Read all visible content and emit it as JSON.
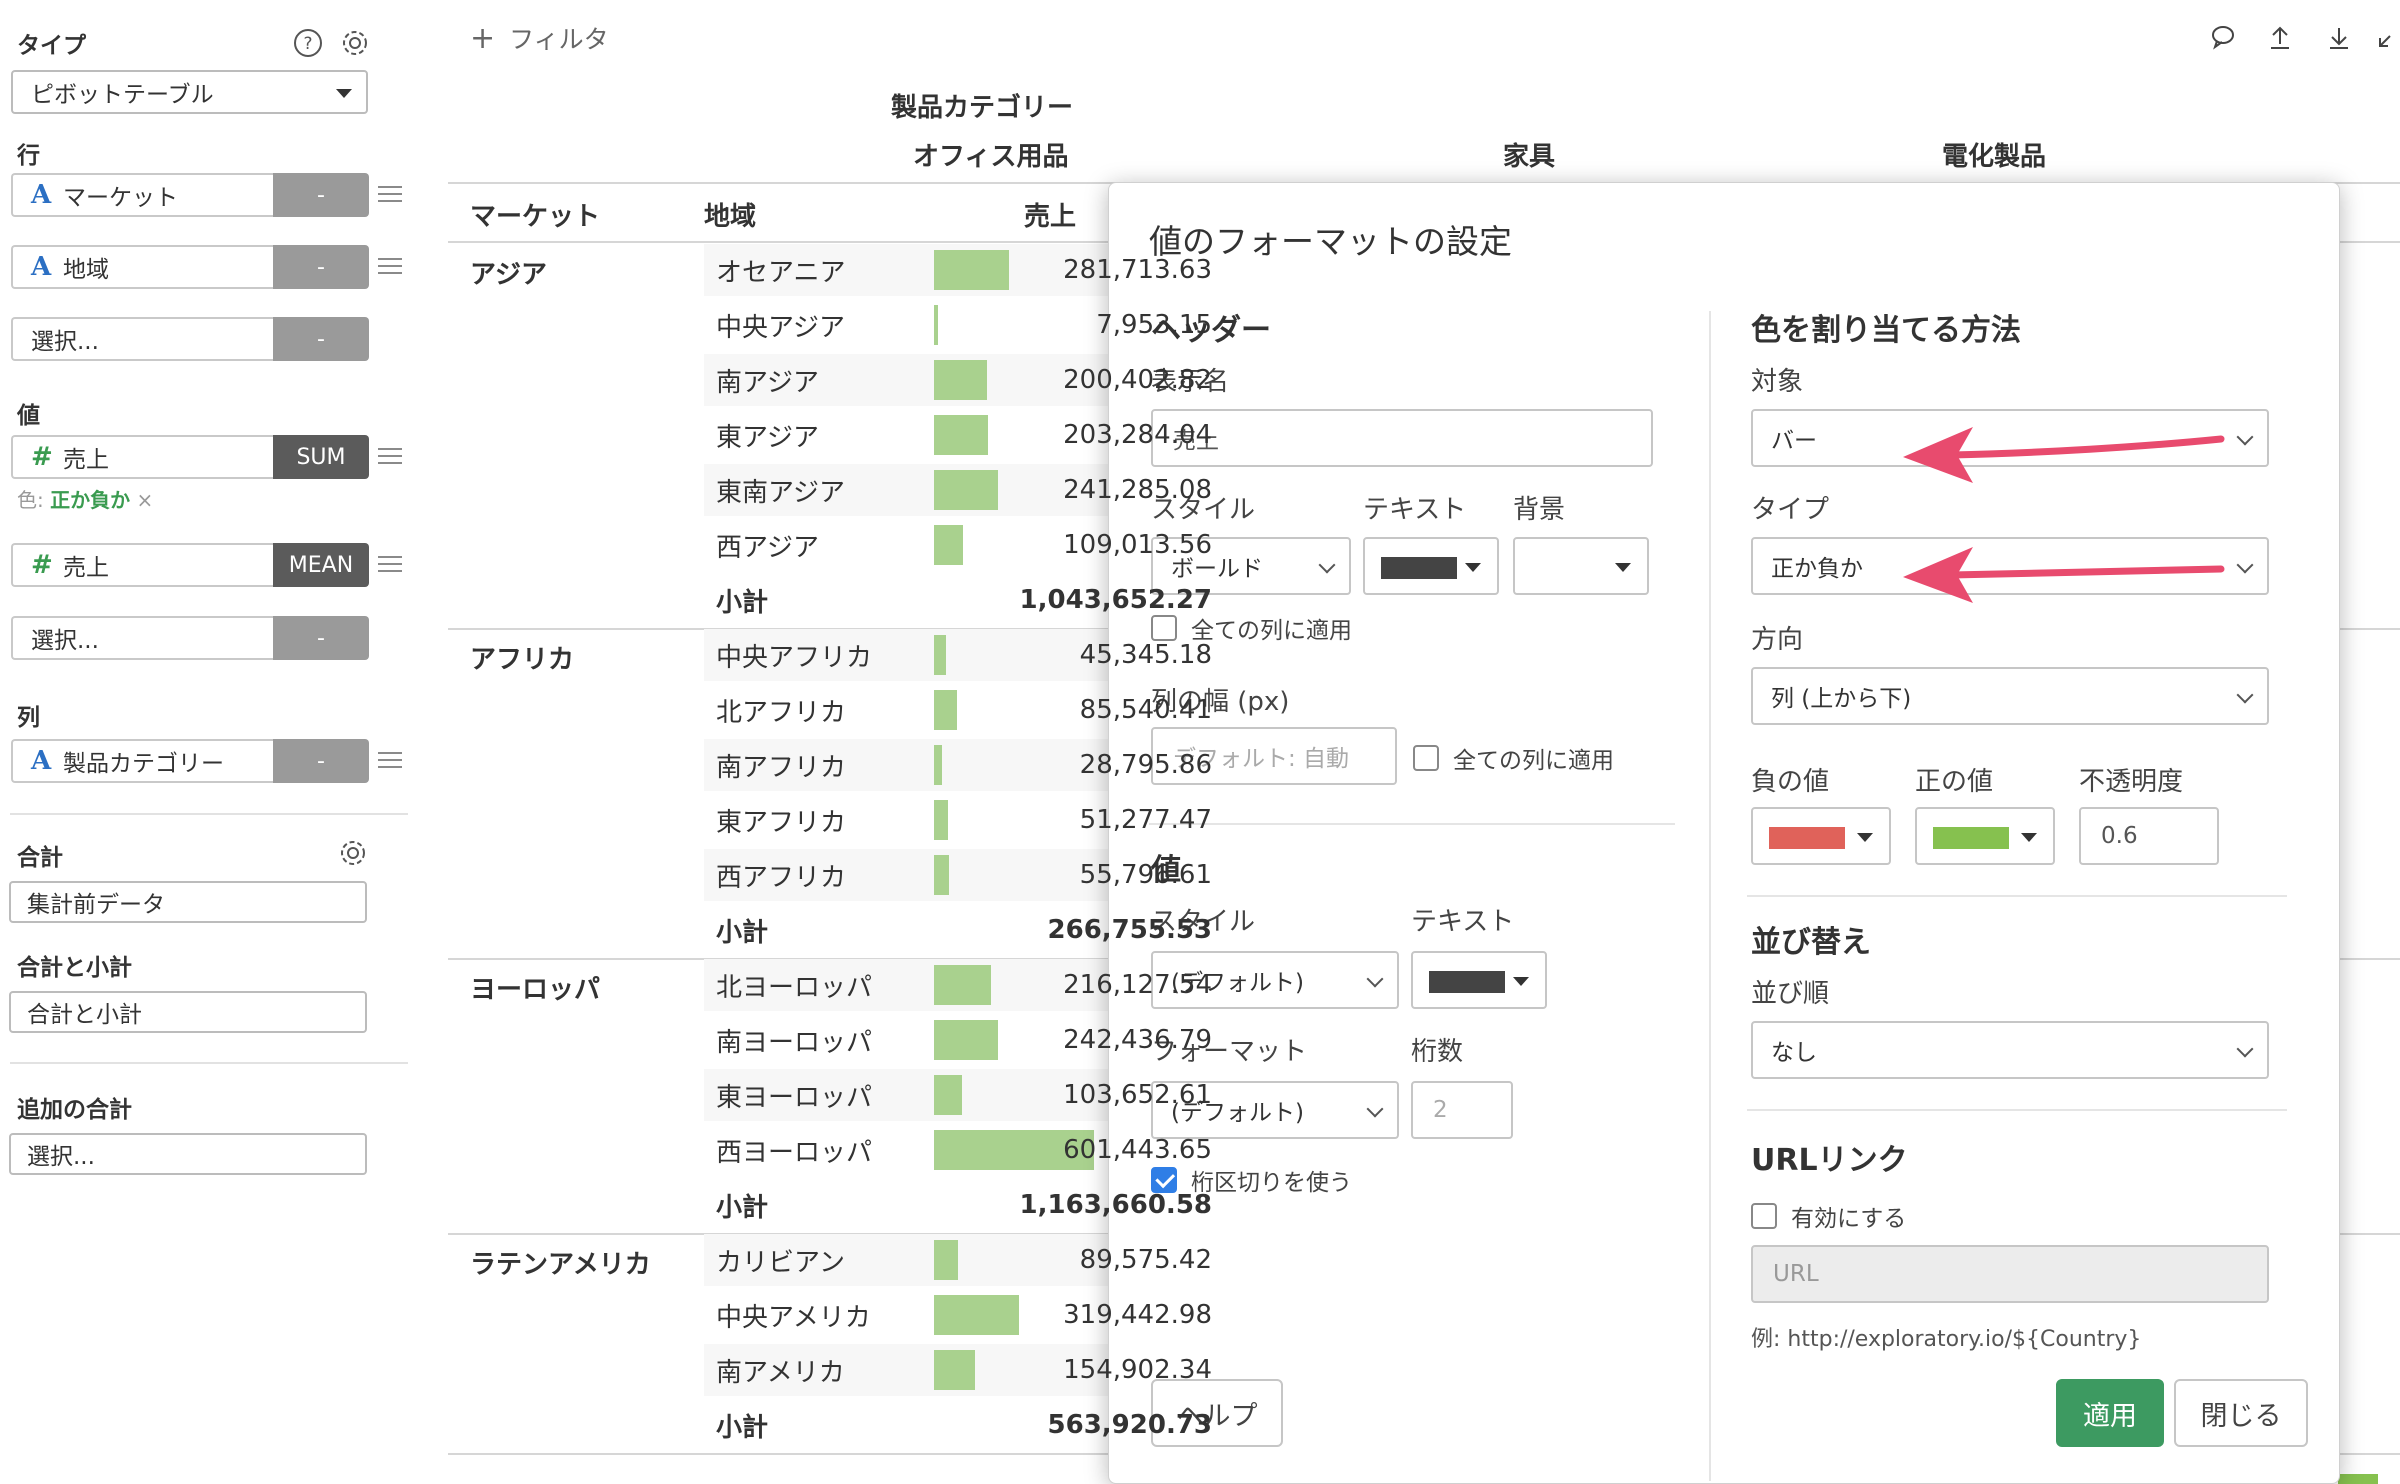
{
  "sidebar": {
    "type_label": "タイプ",
    "type_value": "ピボットテーブル",
    "rows_label": "行",
    "rows": [
      {
        "type": "A",
        "name": "マーケット",
        "agg": "-"
      },
      {
        "type": "A",
        "name": "地域",
        "agg": "-"
      },
      {
        "type": "",
        "name": "選択...",
        "agg": "-"
      }
    ],
    "values_label": "値",
    "values": [
      {
        "type": "#",
        "name": "売上",
        "agg": "SUM"
      },
      {
        "type": "#",
        "name": "売上",
        "agg": "MEAN"
      },
      {
        "type": "",
        "name": "選択...",
        "agg": "-"
      }
    ],
    "color_prefix": "色:",
    "color_value": "正か負か",
    "color_remove": "×",
    "columns_label": "列",
    "columns": [
      {
        "type": "A",
        "name": "製品カテゴリー",
        "agg": "-"
      }
    ],
    "total_label": "合計",
    "total_value": "集計前データ",
    "subtotal_label": "合計と小計",
    "subtotal_value": "合計と小計",
    "extra_total_label": "追加の合計",
    "extra_total_value": "選択..."
  },
  "toolbar": {
    "filter_label": "フィルタ",
    "plus": "+"
  },
  "pivot": {
    "column_group_header": "製品カテゴリー",
    "col_categories": [
      "オフィス用品",
      "家具",
      "電化製品"
    ],
    "headers": {
      "market": "マーケット",
      "region": "地域",
      "value": "売上"
    },
    "bar_max": 601443.65,
    "groups": [
      {
        "market": "アジア",
        "rows": [
          {
            "region": "オセアニア",
            "value": "281,713.63",
            "num": 281713.63
          },
          {
            "region": "中央アジア",
            "value": "7,953.15",
            "num": 7953.15
          },
          {
            "region": "南アジア",
            "value": "200,402.82",
            "num": 200402.82
          },
          {
            "region": "東アジア",
            "value": "203,284.04",
            "num": 203284.04
          },
          {
            "region": "東南アジア",
            "value": "241,285.08",
            "num": 241285.08
          },
          {
            "region": "西アジア",
            "value": "109,013.56",
            "num": 109013.56
          }
        ],
        "subtotal_label": "小計",
        "subtotal": "1,043,652.27"
      },
      {
        "market": "アフリカ",
        "rows": [
          {
            "region": "中央アフリカ",
            "value": "45,345.18",
            "num": 45345.18
          },
          {
            "region": "北アフリカ",
            "value": "85,540.41",
            "num": 85540.41
          },
          {
            "region": "南アフリカ",
            "value": "28,795.86",
            "num": 28795.86
          },
          {
            "region": "東アフリカ",
            "value": "51,277.47",
            "num": 51277.47
          },
          {
            "region": "西アフリカ",
            "value": "55,796.61",
            "num": 55796.61
          }
        ],
        "subtotal_label": "小計",
        "subtotal": "266,755.53"
      },
      {
        "market": "ヨーロッパ",
        "rows": [
          {
            "region": "北ヨーロッパ",
            "value": "216,127.54",
            "num": 216127.54
          },
          {
            "region": "南ヨーロッパ",
            "value": "242,436.79",
            "num": 242436.79
          },
          {
            "region": "東ヨーロッパ",
            "value": "103,652.61",
            "num": 103652.61
          },
          {
            "region": "西ヨーロッパ",
            "value": "601,443.65",
            "num": 601443.65
          }
        ],
        "subtotal_label": "小計",
        "subtotal": "1,163,660.58"
      },
      {
        "market": "ラテンアメリカ",
        "rows": [
          {
            "region": "カリビアン",
            "value": "89,575.42",
            "num": 89575.42
          },
          {
            "region": "中央アメリカ",
            "value": "319,442.98",
            "num": 319442.98
          },
          {
            "region": "南アメリカ",
            "value": "154,902.34",
            "num": 154902.34
          }
        ],
        "subtotal_label": "小計",
        "subtotal": "563,920.73"
      }
    ]
  },
  "dialog": {
    "title": "値のフォーマットの設定",
    "header_section": "ヘッダー",
    "display_name_label": "表示名",
    "display_name_value": "売上",
    "style_label": "スタイル",
    "style_value": "ボールド",
    "text_label": "テキスト",
    "bg_label": "背景",
    "apply_all_cols": "全ての列に適用",
    "col_width_label": "列の幅 (px)",
    "col_width_placeholder": "デフォルト: 自動",
    "apply_all_cols_2": "全ての列に適用",
    "value_section": "値",
    "value_style_label": "スタイル",
    "value_style_value": "(デフォルト)",
    "value_text_label": "テキスト",
    "format_label": "フォーマット",
    "format_value": "(デフォルト)",
    "digits_label": "桁数",
    "digits_placeholder": "2",
    "thousands_sep": "桁区切りを使う",
    "color_section": "色を割り当てる方法",
    "target_label": "対象",
    "target_value": "バー",
    "type_label": "タイプ",
    "type_value": "正か負か",
    "direction_label": "方向",
    "direction_value": "列 (上から下)",
    "neg_label": "負の値",
    "pos_label": "正の値",
    "opacity_label": "不透明度",
    "opacity_value": "0.6",
    "sort_section": "並び替え",
    "sort_order_label": "並び順",
    "sort_order_value": "なし",
    "url_section": "URLリンク",
    "url_enable": "有効にする",
    "url_placeholder": "URL",
    "url_example": "例: http://exploratory.io/${Country}",
    "help_button": "ヘルプ",
    "apply_button": "適用",
    "close_button": "閉じる"
  },
  "colors": {
    "bar": "#a9d18e",
    "negative": "#e0625a",
    "positive": "#86c14f",
    "text_swatch": "#444444",
    "accent_green": "#3d9a61",
    "arrow": "#e84b6e"
  }
}
